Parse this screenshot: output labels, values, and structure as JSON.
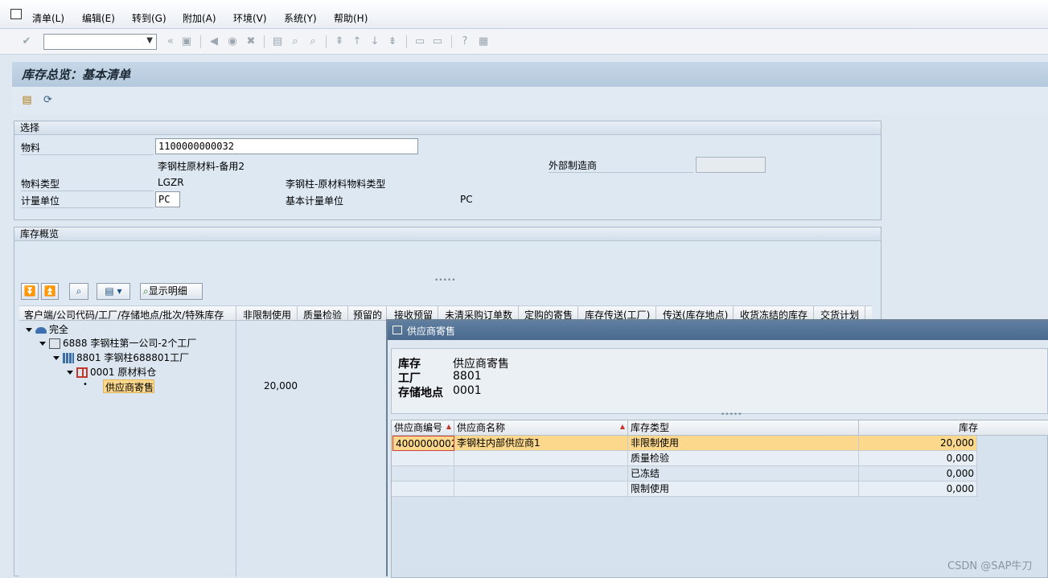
{
  "menu": [
    "清单(L)",
    "编辑(E)",
    "转到(G)",
    "附加(A)",
    "环境(V)",
    "系统(Y)",
    "帮助(H)"
  ],
  "page_title": "库存总览：基本清单",
  "selection": {
    "header": "选择",
    "material_label": "物料",
    "material_value": "1100000000032",
    "material_desc": "李钢柱原材料-备用2",
    "ext_mfr_label": "外部制造商",
    "material_type_label": "物料类型",
    "material_type_value": "LGZR",
    "material_type_desc": "李钢柱-原材料物料类型",
    "uom_label": "计量单位",
    "uom_value": "PC",
    "base_uom_label": "基本计量单位",
    "base_uom_value": "PC"
  },
  "overview": {
    "header": "库存概览",
    "detail_button": "显示明细",
    "columns": [
      "客户端/公司代码/工厂/存储地点/批次/特殊库存",
      "非限制使用",
      "质量检验",
      "预留的",
      "接收预留",
      "未清采购订单数",
      "定购的寄售",
      "库存传送(工厂)",
      "传送(库存地点)",
      "收货冻结的库存",
      "交货计划"
    ],
    "tree": [
      {
        "label": "完全"
      },
      {
        "label": "6888 李钢柱第一公司-2个工厂"
      },
      {
        "label": "8801 李钢柱688801工厂"
      },
      {
        "label": "0001 原材料仓"
      },
      {
        "label": "供应商寄售",
        "value": "20,000"
      }
    ]
  },
  "dialog": {
    "title": "供应商寄售",
    "info": [
      {
        "label": "库存",
        "value": "供应商寄售"
      },
      {
        "label": "工厂",
        "value": "8801"
      },
      {
        "label": "存储地点",
        "value": "0001"
      }
    ],
    "columns": [
      "供应商编号",
      "供应商名称",
      "库存类型",
      "库存"
    ],
    "rows": [
      [
        "4000000002",
        "李钢柱内部供应商1",
        "非限制使用",
        "20,000"
      ],
      [
        "",
        "",
        "质量检验",
        "0,000"
      ],
      [
        "",
        "",
        "已冻结",
        "0,000"
      ],
      [
        "",
        "",
        "限制使用",
        "0,000"
      ]
    ]
  },
  "watermark": "CSDN @SAP牛刀"
}
